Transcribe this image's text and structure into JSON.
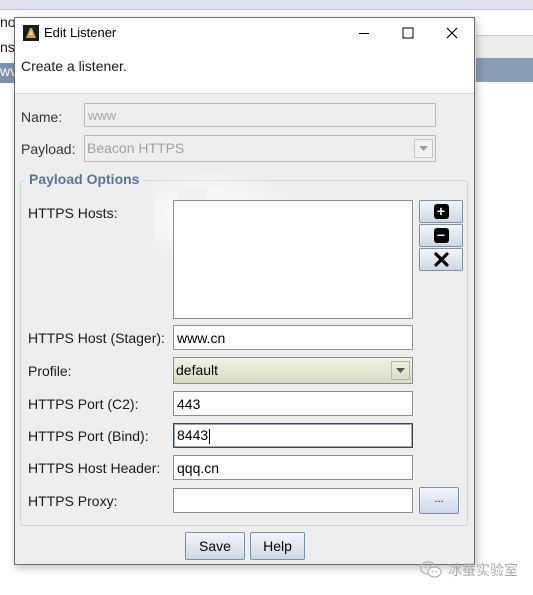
{
  "background": {
    "left_texts": [
      "no",
      "ns",
      "wv"
    ]
  },
  "dialog": {
    "title": "Edit Listener",
    "description": "Create a listener.",
    "name": {
      "label": "Name:",
      "value": "www"
    },
    "payload": {
      "label": "Payload:",
      "value": "Beacon HTTPS"
    },
    "group_title": "Payload Options",
    "https_hosts": {
      "label": "HTTPS Hosts:",
      "items": []
    },
    "host_stager": {
      "label": "HTTPS Host (Stager):",
      "value": "www.cn"
    },
    "profile": {
      "label": "Profile:",
      "value": "default"
    },
    "port_c2": {
      "label": "HTTPS Port (C2):",
      "value": "443"
    },
    "port_bind": {
      "label": "HTTPS Port (Bind):",
      "value": "8443"
    },
    "host_header": {
      "label": "HTTPS Host Header:",
      "value": "qqq.cn"
    },
    "proxy": {
      "label": "HTTPS Proxy:",
      "value": "",
      "browse_label": "..."
    },
    "buttons": {
      "save": "Save",
      "help": "Help"
    }
  },
  "watermark": {
    "text": "冰蚕实验室",
    "icon": "wechat-icon"
  },
  "colors": {
    "group_title": "#5a7494",
    "selected_row": "#8a9db7",
    "button_gradient_bottom": "#cdd8e6"
  }
}
